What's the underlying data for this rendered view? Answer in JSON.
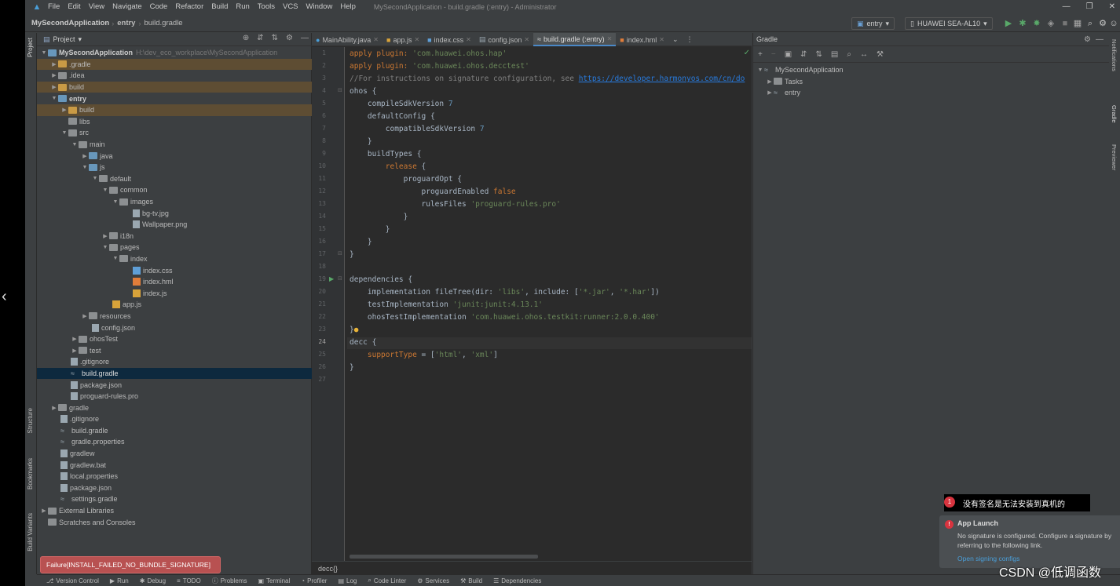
{
  "menubar": {
    "items": [
      "File",
      "Edit",
      "View",
      "Navigate",
      "Code",
      "Refactor",
      "Build",
      "Run",
      "Tools",
      "VCS",
      "Window",
      "Help"
    ],
    "window_title": "MySecondApplication - build.gradle (:entry) - Administrator",
    "minimize": "—",
    "restore": "❐",
    "close": "✕"
  },
  "navbar": {
    "project": "MySecondApplication",
    "module": "entry",
    "file": "build.gradle",
    "run_config": "entry",
    "device": "HUAWEI SEA-AL10"
  },
  "left_tools": {
    "project": "Project",
    "structure": "Structure",
    "bookmarks": "Bookmarks",
    "build_variants": "Build Variants"
  },
  "project_panel": {
    "title": "Project",
    "root_name": "MySecondApplication",
    "root_path": "H:\\dev_eco_workplace\\MySecondApplication",
    "tree": [
      {
        "label": ".gradle"
      },
      {
        "label": ".idea"
      },
      {
        "label": "build"
      },
      {
        "label": "entry"
      },
      {
        "label": "build"
      },
      {
        "label": "libs"
      },
      {
        "label": "src"
      },
      {
        "label": "main"
      },
      {
        "label": "java"
      },
      {
        "label": "js"
      },
      {
        "label": "default"
      },
      {
        "label": "common"
      },
      {
        "label": "images"
      },
      {
        "label": "bg-tv.jpg"
      },
      {
        "label": "Wallpaper.png"
      },
      {
        "label": "i18n"
      },
      {
        "label": "pages"
      },
      {
        "label": "index"
      },
      {
        "label": "index.css"
      },
      {
        "label": "index.hml"
      },
      {
        "label": "index.js"
      },
      {
        "label": "app.js"
      },
      {
        "label": "resources"
      },
      {
        "label": "config.json"
      },
      {
        "label": "ohosTest"
      },
      {
        "label": "test"
      },
      {
        "label": ".gitignore"
      },
      {
        "label": "build.gradle"
      },
      {
        "label": "package.json"
      },
      {
        "label": "proguard-rules.pro"
      },
      {
        "label": "gradle"
      },
      {
        "label": ".gitignore"
      },
      {
        "label": "build.gradle"
      },
      {
        "label": "gradle.properties"
      },
      {
        "label": "gradlew"
      },
      {
        "label": "gradlew.bat"
      },
      {
        "label": "local.properties"
      },
      {
        "label": "package.json"
      },
      {
        "label": "settings.gradle"
      },
      {
        "label": "External Libraries"
      },
      {
        "label": "Scratches and Consoles"
      }
    ]
  },
  "editor": {
    "tabs": [
      "MainAbility.java",
      "app.js",
      "index.css",
      "config.json",
      "build.gradle (:entry)",
      "index.hml"
    ],
    "active_tab": "build.gradle (:entry)",
    "breadcrumb": "decc{}",
    "line_numbers": [
      "1",
      "2",
      "3",
      "4",
      "5",
      "6",
      "7",
      "8",
      "9",
      "10",
      "11",
      "12",
      "13",
      "14",
      "15",
      "16",
      "17",
      "18",
      "19",
      "20",
      "21",
      "22",
      "23",
      "24",
      "25",
      "26",
      "27"
    ],
    "code": {
      "l1_kw": "apply plugin: ",
      "l1_str": "'com.huawei.ohos.hap'",
      "l2_kw": "apply plugin: ",
      "l2_str": "'com.huawei.ohos.decctest'",
      "l3_cm": "//For instructions on signature configuration, see ",
      "l3_link": "https://developer.harmonyos.com/cn/do",
      "l4": "ohos {",
      "l5_a": "    compileSdkVersion ",
      "l5_n": "7",
      "l6": "    defaultConfig {",
      "l7_a": "        compatibleSdkVersion ",
      "l7_n": "7",
      "l8": "    }",
      "l9": "    buildTypes {",
      "l10_a": "        ",
      "l10_kw": "release",
      "l10_b": " {",
      "l11": "            proguardOpt {",
      "l12_a": "                proguardEnabled ",
      "l12_kw": "false",
      "l13_a": "                rulesFiles ",
      "l13_str": "'proguard-rules.pro'",
      "l14": "            }",
      "l15": "        }",
      "l16": "    }",
      "l17": "}",
      "l19": "dependencies {",
      "l20_a": "    implementation fileTree(dir: ",
      "l20_s1": "'libs'",
      "l20_b": ", include: [",
      "l20_s2": "'*.jar'",
      "l20_c": ", ",
      "l20_s3": "'*.har'",
      "l20_d": "])",
      "l21_a": "    testImplementation ",
      "l21_str": "'junit:junit:4.13.1'",
      "l22_a": "    ohosTestImplementation ",
      "l22_str": "'com.huawei.ohos.testkit:runner:2.0.0.400'",
      "l23": "}",
      "l24": "decc {",
      "l25_a": "    supportType",
      "l25_b": " = [",
      "l25_s1": "'html'",
      "l25_c": ", ",
      "l25_s2": "'xml'",
      "l25_d": "]",
      "l26": "}"
    }
  },
  "gradle_panel": {
    "title": "Gradle",
    "root": "MySecondApplication",
    "children": [
      "Tasks",
      "entry"
    ]
  },
  "right_tools": {
    "notifications": "Notifications",
    "gradle": "Gradle",
    "previewer": "Previewer"
  },
  "statusbar": [
    "Version Control",
    "Run",
    "Debug",
    "TODO",
    "Problems",
    "Terminal",
    "Profiler",
    "Log",
    "Code Linter",
    "Services",
    "Build",
    "Dependencies"
  ],
  "failure_toast": "Failure[INSTALL_FAILED_NO_BUNDLE_SIGNATURE]",
  "annotation": {
    "badge": "1",
    "text": "没有签名是无法安装到真机的"
  },
  "notification": {
    "title": "App Launch",
    "body": "No signature is configured. Configure a signature by referring to the following link.",
    "link": "Open signing configs"
  },
  "watermark": "CSDN @低调函数",
  "colors": {
    "accent": "#4a88c7",
    "error": "#d8343f",
    "selected_row": "#0d293e",
    "excluded_folder": "#5e4d33"
  }
}
